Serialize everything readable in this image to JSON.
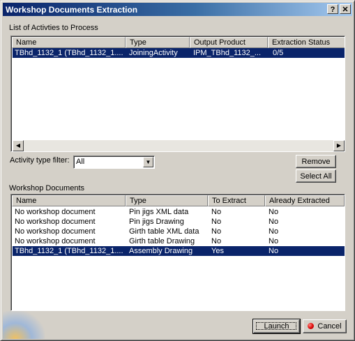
{
  "window": {
    "title": "Workshop Documents Extraction",
    "help_label": "?",
    "close_label": "✕"
  },
  "activities": {
    "group_label": "List of Activties to Process",
    "columns": [
      "Name",
      "Type",
      "Output Product",
      "Extraction Status"
    ],
    "rows": [
      [
        "TBhd_1132_1 (TBhd_1132_1....",
        "JoiningActivity",
        "IPM_TBhd_1132_...",
        "0/5"
      ]
    ],
    "selected_row": 0,
    "scroll_left": "◀",
    "scroll_right": "▶"
  },
  "filter": {
    "label": "Activity type filter:",
    "value": "All",
    "arrow": "▼"
  },
  "buttons": {
    "remove": "Remove",
    "select_all": "Select All",
    "launch": "Launch",
    "cancel": "Cancel"
  },
  "documents": {
    "group_label": "Workshop Documents",
    "columns": [
      "Name",
      "Type",
      "To Extract",
      "Already Extracted"
    ],
    "rows": [
      [
        "No workshop document",
        "Pin jigs XML data",
        "No",
        "No"
      ],
      [
        "No workshop document",
        "Pin jigs Drawing",
        "No",
        "No"
      ],
      [
        "No workshop document",
        "Girth table XML data",
        "No",
        "No"
      ],
      [
        "No workshop document",
        "Girth table Drawing",
        "No",
        "No"
      ],
      [
        "TBhd_1132_1 (TBhd_1132_1....",
        "Assembly Drawing",
        "Yes",
        "No"
      ]
    ],
    "selected_row": 4
  },
  "colors": {
    "selection": "#0a246a",
    "face": "#d4d0c8"
  }
}
